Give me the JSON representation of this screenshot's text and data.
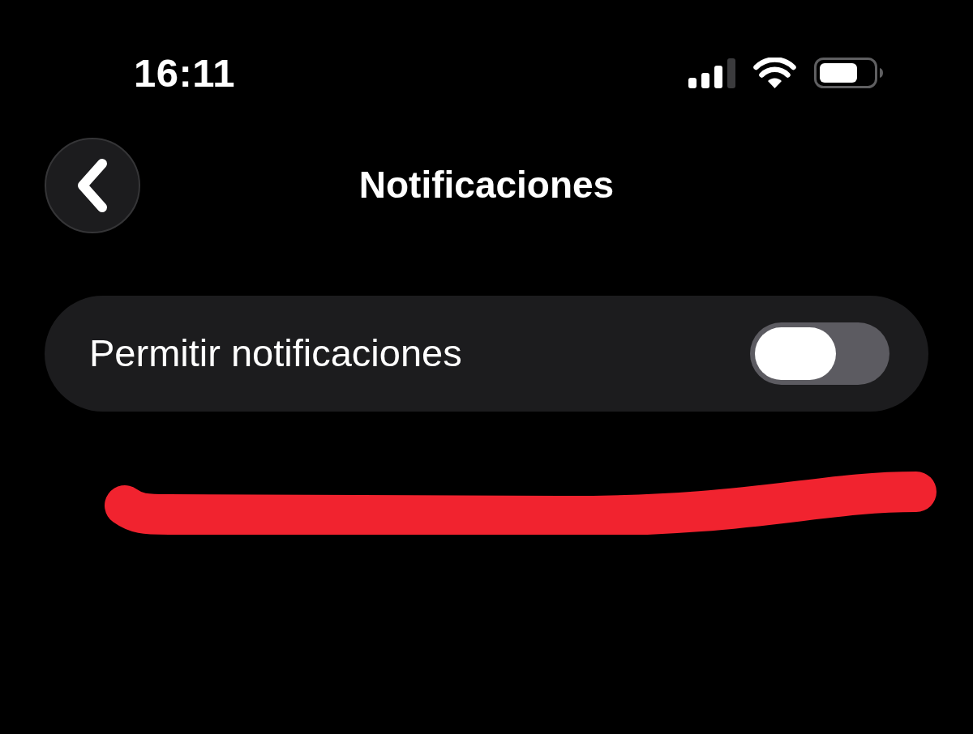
{
  "status_bar": {
    "time": "16:11"
  },
  "header": {
    "title": "Notificaciones"
  },
  "settings": [
    {
      "kind": "toggle",
      "label": "Permitir notificaciones",
      "on": false
    }
  ]
}
